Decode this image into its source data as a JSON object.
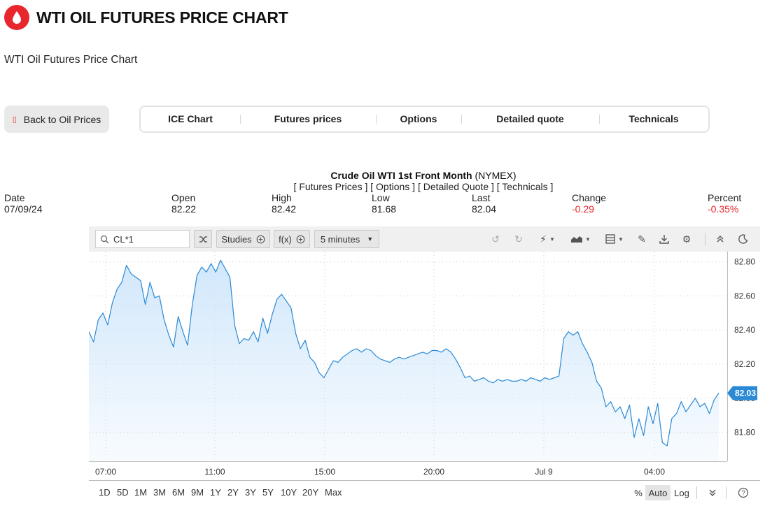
{
  "page": {
    "title": "WTI OIL FUTURES PRICE CHART",
    "subtitle": "WTI Oil Futures Price Chart"
  },
  "nav": {
    "back_label": "Back to Oil Prices",
    "tabs": [
      "ICE Chart",
      "Futures prices",
      "Options",
      "Detailed quote",
      "Technicals"
    ]
  },
  "quote": {
    "instrument": "Crude Oil WTI 1st Front Month",
    "exchange": "(NYMEX)",
    "links": "[ Futures Prices ] [ Options ] [ Detailed Quote ] [ Technicals ]",
    "columns": [
      {
        "label": "Date",
        "value": "07/09/24",
        "negative": false
      },
      {
        "label": "Open",
        "value": "82.22",
        "negative": false
      },
      {
        "label": "High",
        "value": "82.42",
        "negative": false
      },
      {
        "label": "Low",
        "value": "81.68",
        "negative": false
      },
      {
        "label": "Last",
        "value": "82.04",
        "negative": false
      },
      {
        "label": "Change",
        "value": "-0.29",
        "negative": true
      },
      {
        "label": "Percent",
        "value": "-0.35%",
        "negative": true
      }
    ]
  },
  "toolbar": {
    "symbol": "CL*1",
    "studies_label": "Studies",
    "fx_label": "f(x)",
    "interval_label": "5 minutes",
    "icons": [
      "search-icon",
      "shuffle-icon",
      "plus-circle-icon",
      "chevron-down-icon",
      "undo-icon",
      "redo-icon",
      "lightning-icon",
      "area-chart-icon",
      "layout-icon",
      "pencil-icon",
      "download-icon",
      "gear-icon",
      "double-chevron-up-icon",
      "moon-icon"
    ]
  },
  "bottom": {
    "ranges": [
      "1D",
      "5D",
      "1M",
      "3M",
      "6M",
      "9M",
      "1Y",
      "2Y",
      "3Y",
      "5Y",
      "10Y",
      "20Y",
      "Max"
    ],
    "scales": [
      "%",
      "Auto",
      "Log"
    ],
    "active_scale": "Auto"
  },
  "colors": {
    "brand": "#e8262d",
    "line": "#2b8ad6",
    "fill_top": "#cfe6fb",
    "price_tag": "#2b8ad6",
    "negative": "#e8262d"
  },
  "chart_data": {
    "type": "area",
    "title": "",
    "xlabel": "",
    "ylabel": "",
    "x_ticks": [
      "07:00",
      "11:00",
      "15:00",
      "20:00",
      "Jul 9",
      "04:00"
    ],
    "y_ticks": [
      81.8,
      82.0,
      82.2,
      82.4,
      82.6,
      82.8
    ],
    "ylim": [
      81.63,
      82.86
    ],
    "last_price": "82.03",
    "grid": true,
    "series": [
      {
        "values": [
          82.39,
          82.33,
          82.46,
          82.5,
          82.43,
          82.56,
          82.64,
          82.68,
          82.78,
          82.73,
          82.71,
          82.69,
          82.55,
          82.68,
          82.59,
          82.6,
          82.46,
          82.37,
          82.3,
          82.48,
          82.39,
          82.31,
          82.55,
          82.72,
          82.77,
          82.74,
          82.79,
          82.74,
          82.81,
          82.76,
          82.71,
          82.43,
          82.32,
          82.35,
          82.34,
          82.39,
          82.33,
          82.47,
          82.38,
          82.49,
          82.58,
          82.61,
          82.57,
          82.53,
          82.38,
          82.29,
          82.34,
          82.24,
          82.21,
          82.15,
          82.12,
          82.17,
          82.22,
          82.21,
          82.24,
          82.26,
          82.28,
          82.29,
          82.27,
          82.29,
          82.28,
          82.25,
          82.23,
          82.22,
          82.21,
          82.23,
          82.24,
          82.23,
          82.24,
          82.25,
          82.26,
          82.27,
          82.26,
          82.28,
          82.28,
          82.27,
          82.29,
          82.27,
          82.23,
          82.18,
          82.12,
          82.13,
          82.1,
          82.11,
          82.12,
          82.1,
          82.09,
          82.11,
          82.1,
          82.11,
          82.1,
          82.1,
          82.11,
          82.1,
          82.12,
          82.11,
          82.1,
          82.12,
          82.11,
          82.12,
          82.13,
          82.35,
          82.39,
          82.37,
          82.39,
          82.32,
          82.27,
          82.21,
          82.1,
          82.06,
          81.95,
          81.98,
          81.92,
          81.95,
          81.88,
          81.96,
          81.77,
          81.88,
          81.78,
          81.95,
          81.85,
          81.97,
          81.74,
          81.72,
          81.88,
          81.91,
          81.98,
          81.92,
          81.96,
          82.0,
          81.95,
          81.97,
          81.91,
          81.99,
          82.03
        ]
      }
    ]
  }
}
